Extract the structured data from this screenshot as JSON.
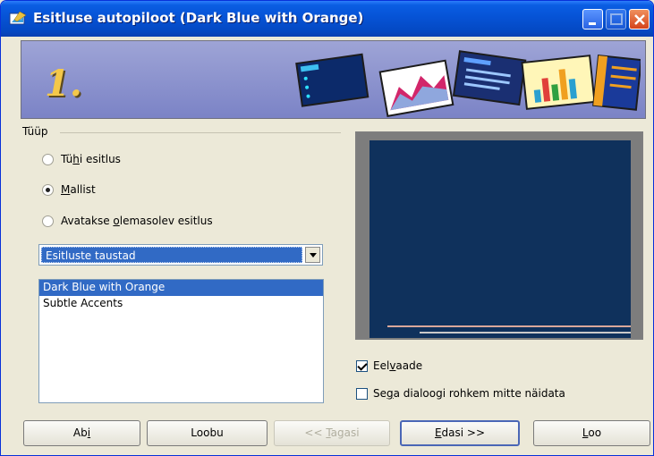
{
  "window": {
    "title": "Esitluse autopiloot (Dark Blue with Orange)"
  },
  "banner": {
    "step": "1."
  },
  "type_group": {
    "label": "Tüüp",
    "options": [
      {
        "pre": "Tü",
        "key": "h",
        "post": "i esitlus",
        "checked": false
      },
      {
        "pre": "",
        "key": "M",
        "post": "allist",
        "checked": true
      },
      {
        "pre": "Avatakse ",
        "key": "o",
        "post": "lemasolev esitlus",
        "checked": false
      }
    ]
  },
  "template_category": {
    "selected": "Esitluste taustad"
  },
  "template_list": {
    "items": [
      "Dark Blue with Orange",
      "Subtle Accents"
    ],
    "selected_index": 0
  },
  "preview_checkbox": {
    "pre": "Eel",
    "key": "v",
    "post": "aade",
    "checked": true
  },
  "dont_show_checkbox": {
    "pre": "Se",
    "key": "g",
    "post": "a dialoogi rohkem mitte näidata",
    "checked": false
  },
  "buttons": {
    "help": {
      "pre": "Ab",
      "key": "i",
      "post": ""
    },
    "cancel": {
      "label": "Loobu"
    },
    "back": {
      "pre": "<< ",
      "key": "T",
      "post": "agasi"
    },
    "next": {
      "pre": "",
      "key": "E",
      "post": "dasi >>"
    },
    "create": {
      "pre": "",
      "key": "L",
      "post": "oo"
    }
  },
  "colors": {
    "titlebar": "#0653d6",
    "selection": "#316ac5",
    "preview_slide": "#0f315c",
    "accent_orange": "#f4c84a"
  }
}
